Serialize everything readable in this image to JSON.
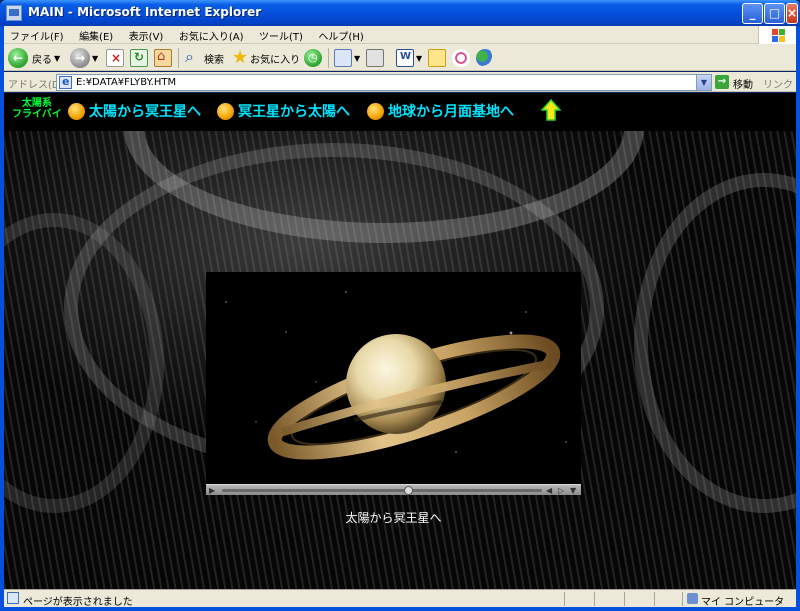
{
  "window": {
    "title": "MAIN - Microsoft Internet Explorer",
    "minimize": "_",
    "maximize": "□",
    "close": "×"
  },
  "menu": {
    "items": [
      "ファイル(F)",
      "編集(E)",
      "表示(V)",
      "お気に入り(A)",
      "ツール(T)",
      "ヘルプ(H)"
    ]
  },
  "toolbar": {
    "back_label": "戻る",
    "search_label": "検索",
    "favorites_label": "お気に入り"
  },
  "address": {
    "label": "アドレス(D)",
    "url": "E:¥DATA¥FLYBY.HTM",
    "go_label": "移動",
    "links_label": "リンク"
  },
  "page": {
    "site_title_line1": "太陽系",
    "site_title_line2": "フライバイ",
    "nav_items": [
      {
        "label": "太陽から冥王星へ"
      },
      {
        "label": "冥王星から太陽へ"
      },
      {
        "label": "地球から月面基地へ"
      }
    ],
    "video_caption": "太陽から冥王星へ",
    "video_progress": 0.58
  },
  "status": {
    "text": "ページが表示されました",
    "zone": "マイ コンピュータ"
  },
  "colors": {
    "nav_text": "#00e5ff",
    "site_title": "#00ff33",
    "xp_blue": "#0550dc",
    "chrome": "#ece9d8"
  },
  "icons": {
    "nav_item": "sun-icon",
    "up": "up-arrow-icon"
  }
}
